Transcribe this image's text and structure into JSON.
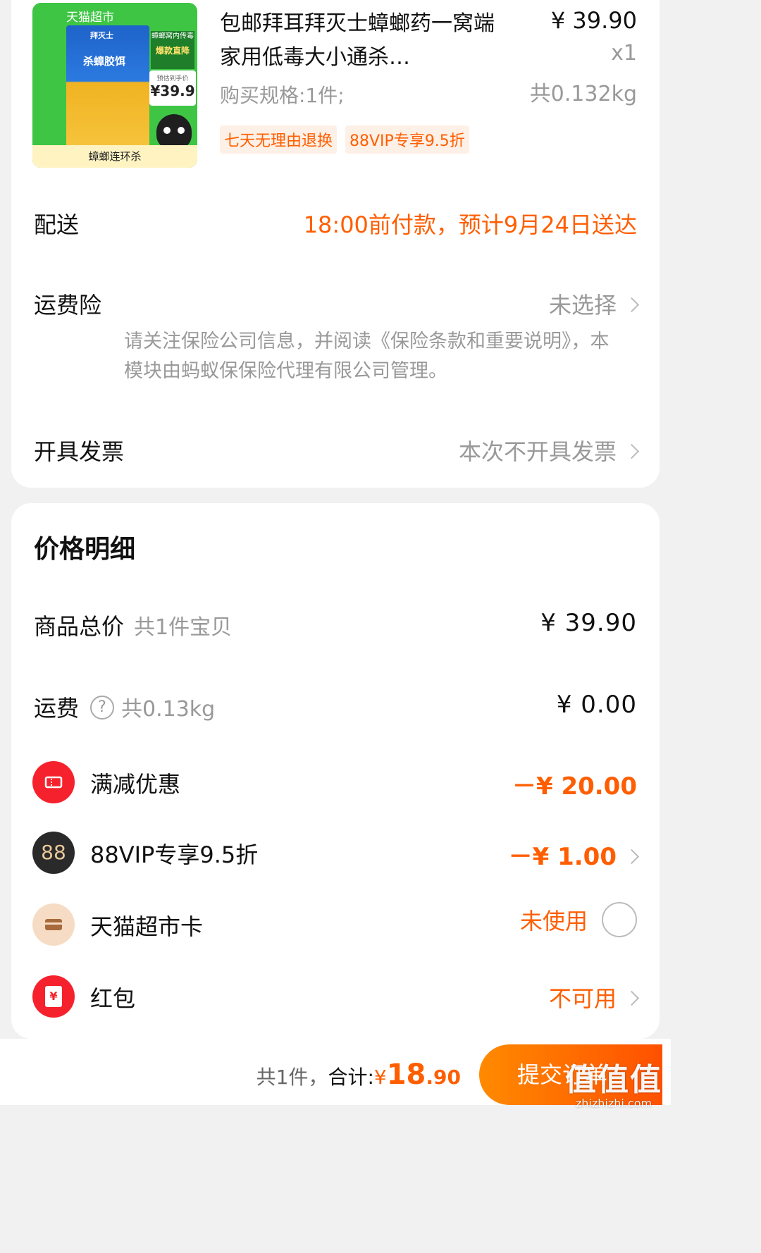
{
  "product": {
    "image": {
      "store_label": "天猫超市",
      "brand": "拜灭士",
      "name": "杀蟑胶饵",
      "badge_top": "蟑螂窝内传毒",
      "badge_hot": "爆款直降",
      "price_label": "预估到手价",
      "price": "¥39.9",
      "bottom_text": "蟑螂连环杀"
    },
    "title": "包邮拜耳拜灭士蟑螂药一窝端家用低毒大小通杀…",
    "spec": "购买规格:1件;",
    "tags": [
      "七天无理由退换",
      "88VIP专享9.5折"
    ],
    "price": "¥ 39.90",
    "qty": "x1",
    "weight": "共0.132kg"
  },
  "delivery": {
    "label": "配送",
    "value": "18:00前付款，预计9月24日送达"
  },
  "shipping_insurance": {
    "label": "运费险",
    "value": "未选择",
    "notice": "请关注保险公司信息，并阅读《保险条款和重要说明》，本模块由蚂蚁保保险代理有限公司管理。"
  },
  "invoice": {
    "label": "开具发票",
    "value": "本次不开具发票"
  },
  "price_detail": {
    "title": "价格明细",
    "goods_total": {
      "label": "商品总价",
      "sub": "共1件宝贝",
      "value": "¥ 39.90"
    },
    "shipping": {
      "label": "运费",
      "sub": "共0.13kg",
      "value": "¥ 0.00"
    },
    "discount": {
      "label": "满减优惠",
      "value": "－¥ 20.00"
    },
    "vip": {
      "label": "88VIP专享9.5折",
      "icon_text": "88",
      "value": "－¥ 1.00"
    },
    "market_card": {
      "label": "天猫超市卡",
      "value": "未使用"
    },
    "red_packet": {
      "label": "红包",
      "icon_text": "¥",
      "value": "不可用"
    }
  },
  "footer": {
    "count": "共1件，",
    "total_label": "合计:",
    "currency": "¥",
    "amount_int": "18",
    "amount_dec": ".90",
    "submit": "提交订单"
  },
  "watermark": {
    "big": "值值值",
    "small": "zhizhizhi.com"
  },
  "colors": {
    "accent": "#ff5e00",
    "vip_icon": "#2a2a2a",
    "red_icon": "#f5222d",
    "card_icon": "#f6dcc4"
  }
}
